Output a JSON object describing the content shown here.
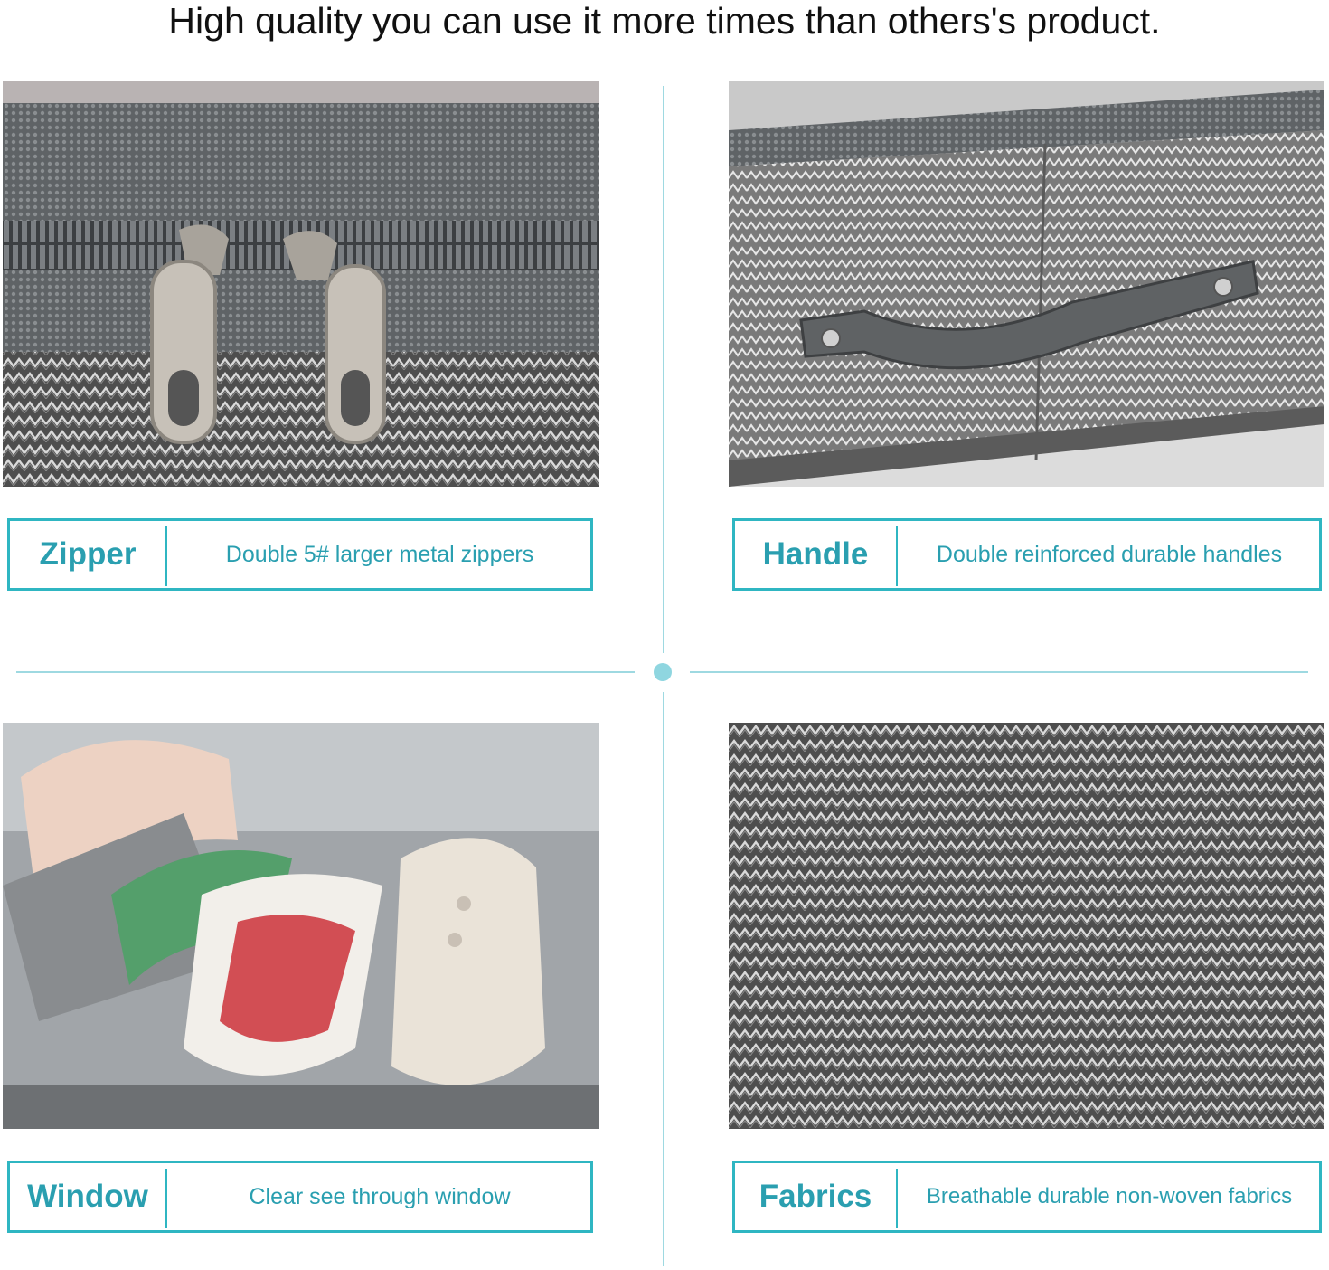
{
  "headline": "High quality you can use it more times than others's product.",
  "accent_color": "#2fb6c2",
  "panels": [
    {
      "title": "Zipper",
      "description": "Double 5# larger metal zippers",
      "image": "zipper-closeup-photo"
    },
    {
      "title": "Handle",
      "description": "Double reinforced durable handles",
      "image": "handle-closeup-photo"
    },
    {
      "title": "Window",
      "description": "Clear see through window",
      "image": "clear-window-shoes-photo"
    },
    {
      "title": "Fabrics",
      "description": "Breathable durable non-woven fabrics",
      "image": "herringbone-fabric-photo"
    }
  ]
}
